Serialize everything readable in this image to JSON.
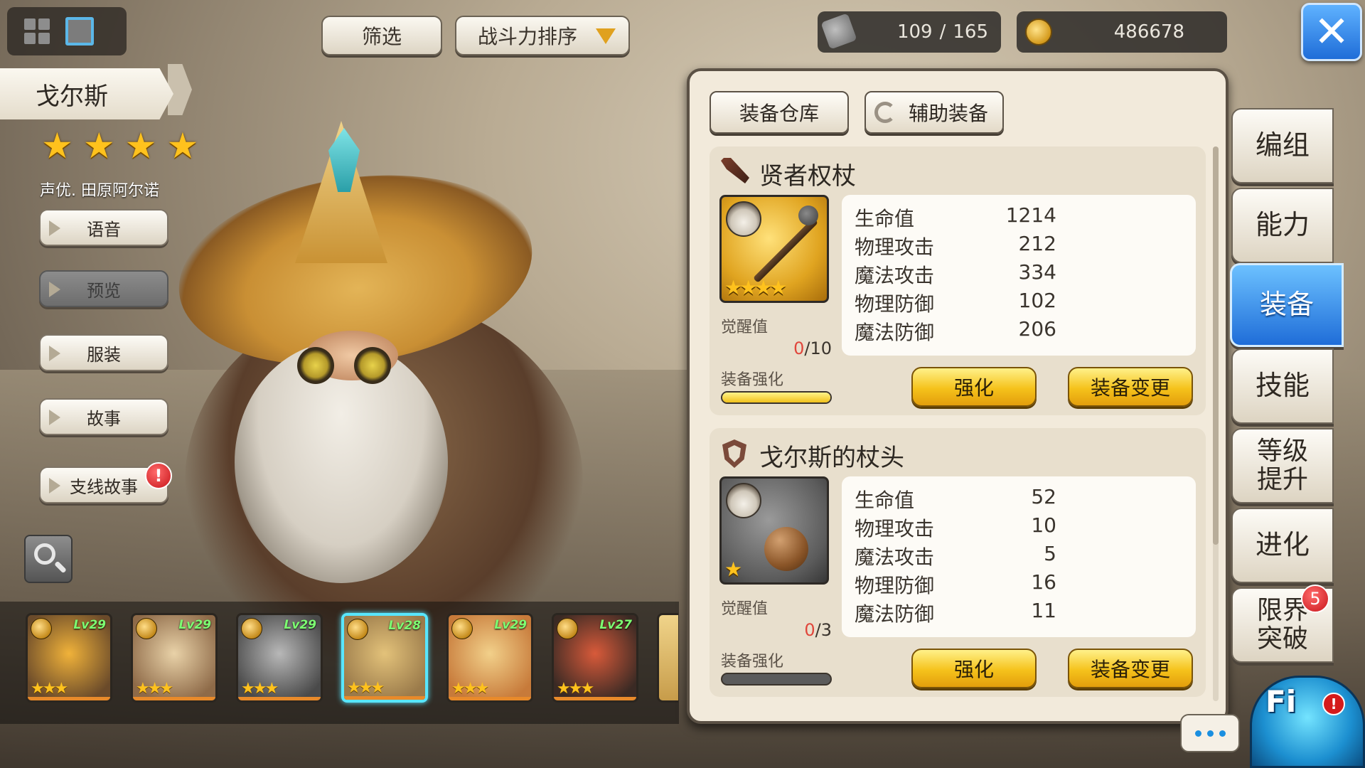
{
  "top_bar": {
    "filter_label": "筛选",
    "sort_label": "战斗力排序",
    "stamina_current": "109",
    "stamina_sep": "/",
    "stamina_max": "165",
    "gold": "486678"
  },
  "hero": {
    "name": "戈尔斯",
    "stars": 4,
    "cv": "声优. 田原阿尔诺"
  },
  "left_menu": {
    "voice": "语音",
    "preview": "预览",
    "costume": "服装",
    "story": "故事",
    "side_story": "支线故事",
    "side_story_badge": "!"
  },
  "hero_list": [
    {
      "level": "Lv29",
      "stars": "★★★",
      "selected": false
    },
    {
      "level": "Lv29",
      "stars": "★★★",
      "selected": false
    },
    {
      "level": "Lv29",
      "stars": "★★★",
      "selected": false
    },
    {
      "level": "Lv28",
      "stars": "★★★",
      "selected": true
    },
    {
      "level": "Lv29",
      "stars": "★★★",
      "selected": false
    },
    {
      "level": "Lv27",
      "stars": "★★★",
      "selected": false
    }
  ],
  "equip_panel": {
    "tab_warehouse": "装备仓库",
    "tab_aux": "辅助装备",
    "items": [
      {
        "name": "贤者权杖",
        "stars": "★★★★",
        "awaken_label": "觉醒值",
        "awaken_current": "0",
        "awaken_max": "/10",
        "enhance_label": "装备强化",
        "enhance_progress": 1.0,
        "stats": [
          {
            "label": "生命值",
            "value": "1214"
          },
          {
            "label": "物理攻击",
            "value": "212"
          },
          {
            "label": "魔法攻击",
            "value": "334"
          },
          {
            "label": "物理防御",
            "value": "102"
          },
          {
            "label": "魔法防御",
            "value": "206"
          }
        ],
        "enhance_btn": "强化",
        "change_btn": "装备变更"
      },
      {
        "name": "戈尔斯的杖头",
        "stars": "★",
        "awaken_label": "觉醒值",
        "awaken_current": "0",
        "awaken_max": "/3",
        "enhance_label": "装备强化",
        "enhance_progress": 0.0,
        "stats": [
          {
            "label": "生命值",
            "value": "52"
          },
          {
            "label": "物理攻击",
            "value": "10"
          },
          {
            "label": "魔法攻击",
            "value": "5"
          },
          {
            "label": "物理防御",
            "value": "16"
          },
          {
            "label": "魔法防御",
            "value": "11"
          }
        ],
        "enhance_btn": "强化",
        "change_btn": "装备变更"
      }
    ]
  },
  "right_nav": {
    "team": "编组",
    "ability": "能力",
    "equipment": "装备",
    "skill": "技能",
    "level_up_1": "等级",
    "level_up_2": "提升",
    "evolve": "进化",
    "limit_1": "限界",
    "limit_2": "突破",
    "limit_badge": "5"
  },
  "mascot": {
    "text": "Fi",
    "alert": "!"
  },
  "colors": {
    "accent_blue": "#1f6dd8",
    "gold_button": "#f5c21b",
    "star": "#ffc21d",
    "level_text": "#7dff72"
  }
}
